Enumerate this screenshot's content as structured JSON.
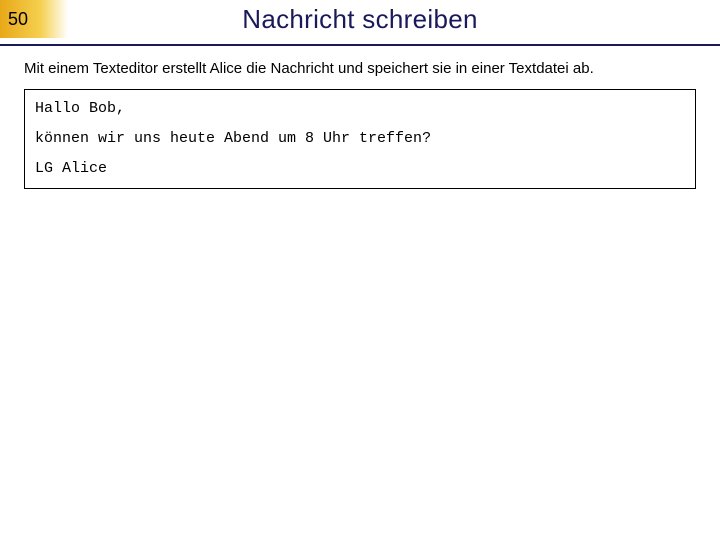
{
  "header": {
    "slide_number": "50",
    "title": "Nachricht schreiben"
  },
  "intro": "Mit einem Texteditor erstellt Alice die Nachricht und speichert sie in einer Textdatei ab.",
  "message": {
    "line1": "Hallo Bob,",
    "line2": "können wir uns heute Abend um 8 Uhr treffen?",
    "line3": "LG Alice"
  }
}
